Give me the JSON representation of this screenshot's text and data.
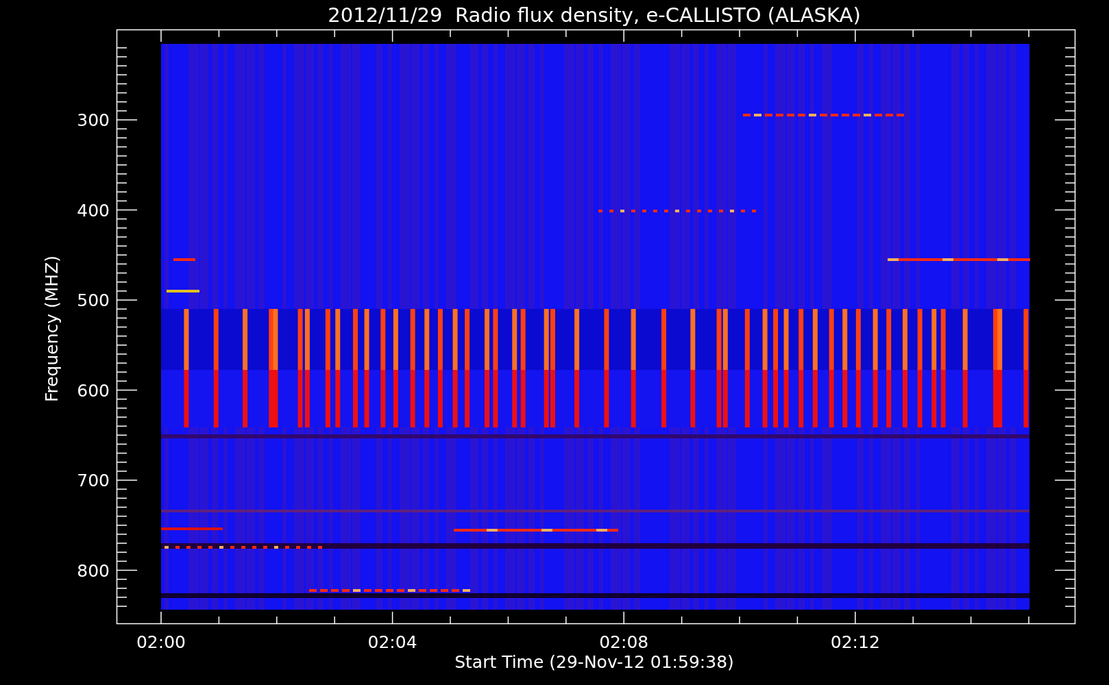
{
  "title": "2012/11/29  Radio flux density, e-CALLISTO (ALASKA)",
  "y_axis": {
    "label": "Frequency (MHZ)",
    "tick_labels": [
      "300",
      "400",
      "500",
      "600",
      "700",
      "800"
    ]
  },
  "x_axis": {
    "label": "Start Time (29-Nov-12 01:59:38)",
    "tick_labels": [
      "02:00",
      "02:04",
      "02:08",
      "02:12"
    ]
  }
}
